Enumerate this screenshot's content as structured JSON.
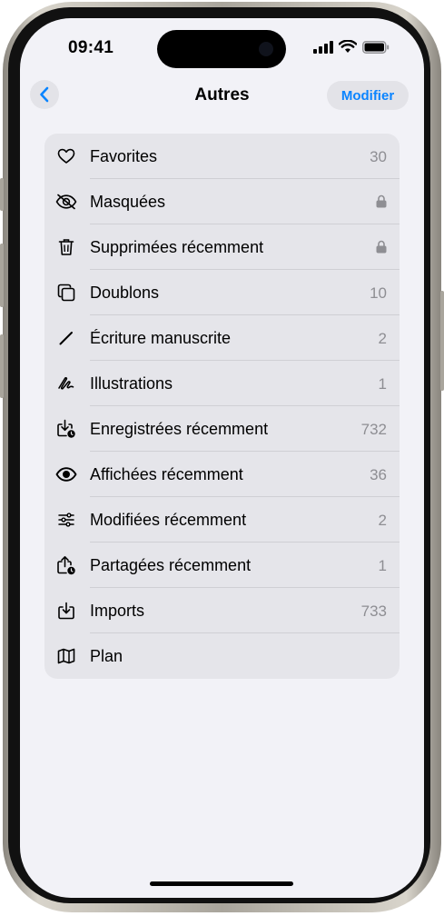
{
  "status_bar": {
    "time": "09:41"
  },
  "nav": {
    "title": "Autres",
    "edit_label": "Modifier"
  },
  "items": [
    {
      "icon": "heart-icon",
      "label": "Favorites",
      "count": "30",
      "locked": false
    },
    {
      "icon": "eye-slash-icon",
      "label": "Masquées",
      "count": "",
      "locked": true
    },
    {
      "icon": "trash-icon",
      "label": "Supprimées récemment",
      "count": "",
      "locked": true
    },
    {
      "icon": "duplicate-icon",
      "label": "Doublons",
      "count": "10",
      "locked": false
    },
    {
      "icon": "pencil-icon",
      "label": "Écriture manuscrite",
      "count": "2",
      "locked": false
    },
    {
      "icon": "scribble-icon",
      "label": "Illustrations",
      "count": "1",
      "locked": false
    },
    {
      "icon": "tray-download-badge-icon",
      "label": "Enregistrées récemment",
      "count": "732",
      "locked": false
    },
    {
      "icon": "eye-icon",
      "label": "Affichées récemment",
      "count": "36",
      "locked": false
    },
    {
      "icon": "sliders-icon",
      "label": "Modifiées récemment",
      "count": "2",
      "locked": false
    },
    {
      "icon": "share-badge-icon",
      "label": "Partagées récemment",
      "count": "1",
      "locked": false
    },
    {
      "icon": "tray-download-icon",
      "label": "Imports",
      "count": "733",
      "locked": false
    },
    {
      "icon": "map-icon",
      "label": "Plan",
      "count": "",
      "locked": false
    }
  ],
  "colors": {
    "accent": "#0a84ff",
    "background": "#f2f2f7",
    "list_bg": "#e5e5ea",
    "secondary_text": "#8e8e93"
  }
}
